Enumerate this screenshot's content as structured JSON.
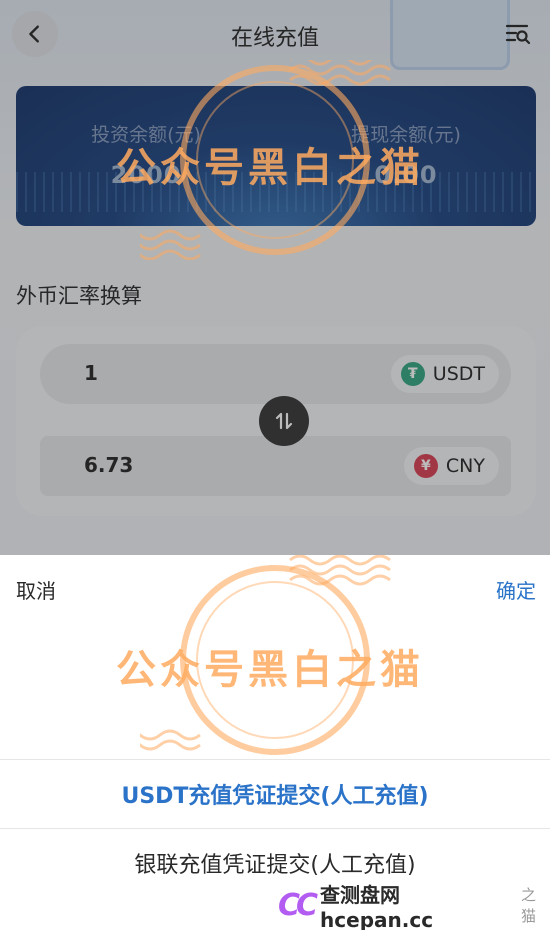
{
  "header": {
    "title": "在线充值",
    "back_icon": "chevron-left-icon",
    "menu_icon": "menu-search-icon"
  },
  "balance": {
    "invest_label": "投资余额(元)",
    "invest_value": "2000",
    "withdraw_label": "提现余额(元)",
    "withdraw_value": "0.00"
  },
  "converter": {
    "section_title": "外币汇率换算",
    "from": {
      "value": "1",
      "currency": "USDT",
      "icon": "tether-icon",
      "icon_color": "#26a17b"
    },
    "to": {
      "value": "6.73",
      "currency": "CNY",
      "icon": "yuan-icon",
      "icon_color": "#d7364a"
    },
    "swap_icon": "swap-vertical-icon"
  },
  "sheet": {
    "cancel_label": "取消",
    "confirm_label": "确定",
    "options": [
      {
        "label": "USDT充值凭证提交(人工充值)",
        "selected": true
      },
      {
        "label": "银联充值凭证提交(人工充值)",
        "selected": false
      }
    ]
  },
  "watermark": {
    "text": "公众号黑白之猫",
    "brand_text": "查测盘网 hcepan.cc",
    "brand_sub": "之猫"
  },
  "colors": {
    "accent_blue": "#2a73c9",
    "watermark_orange": "#ffaa5f"
  }
}
